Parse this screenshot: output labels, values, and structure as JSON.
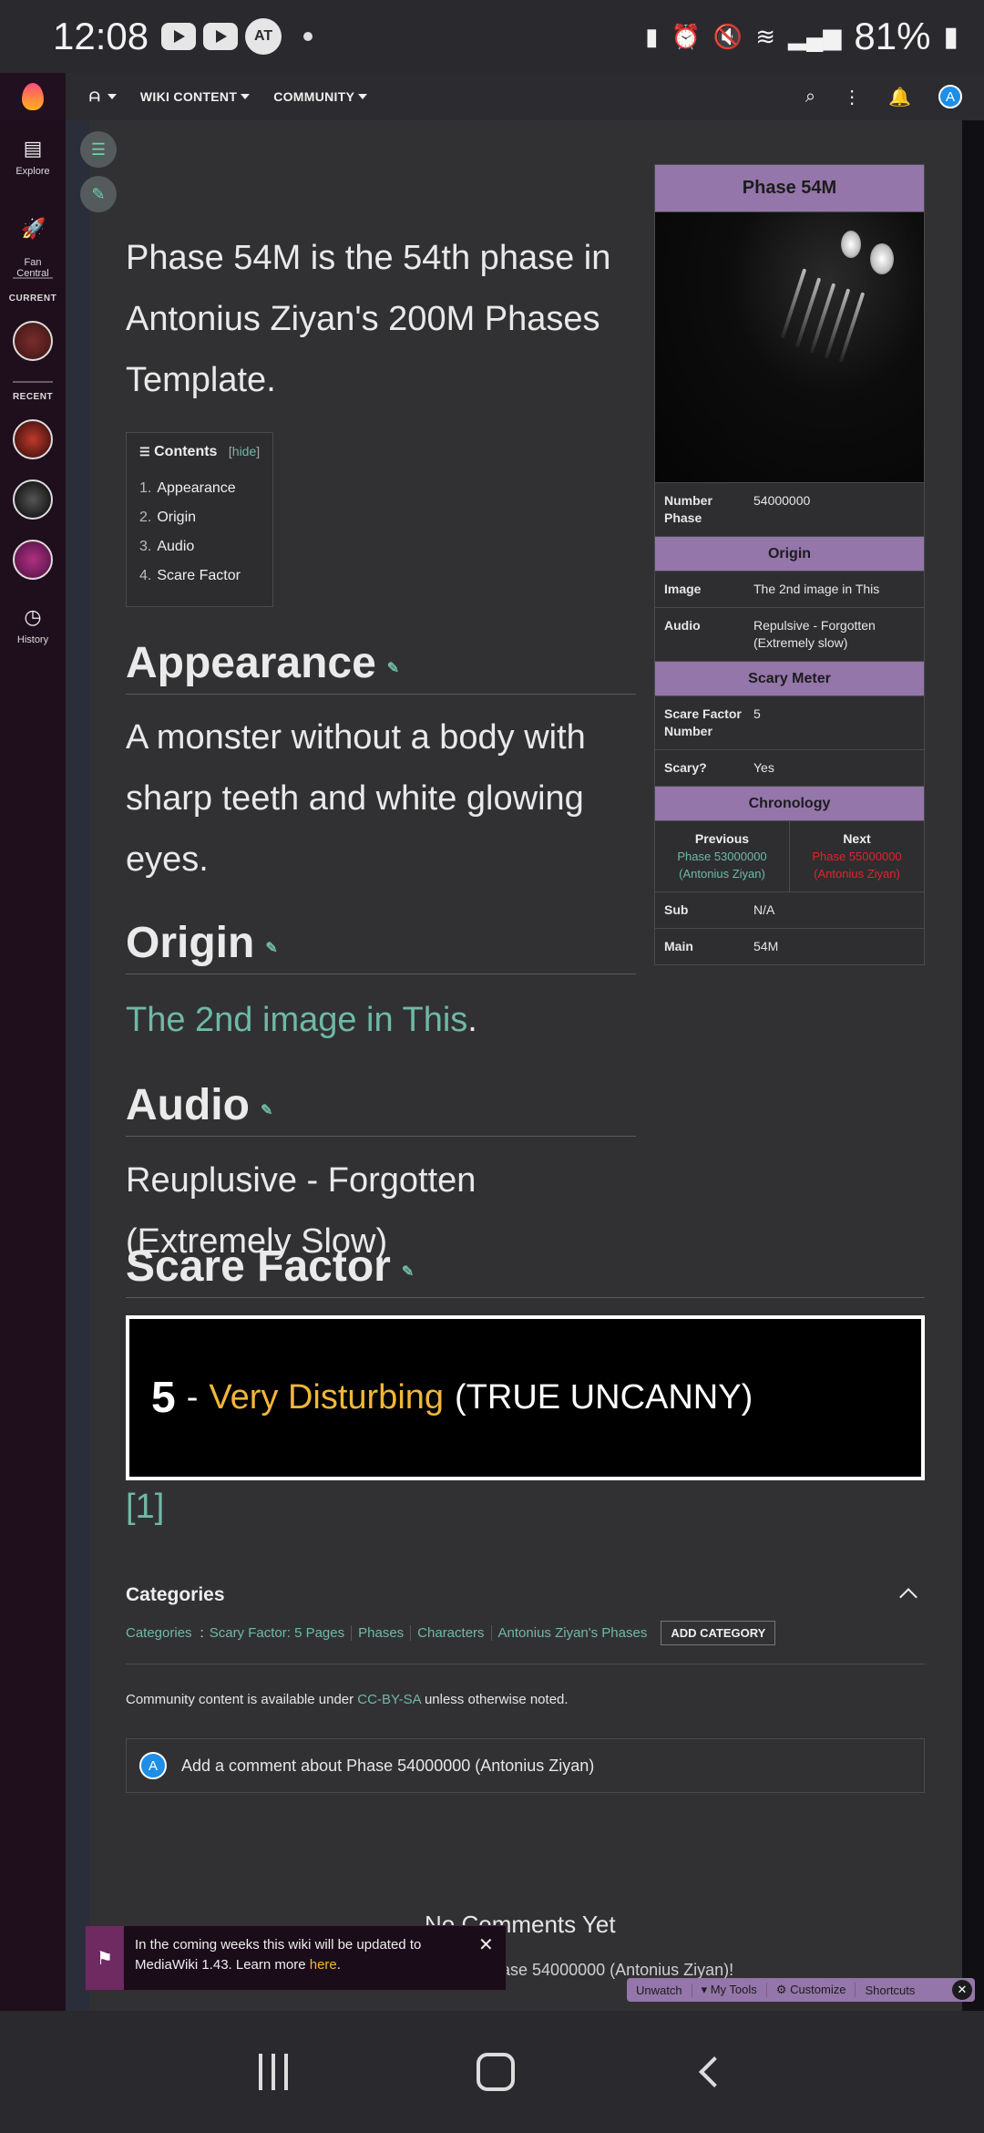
{
  "status_bar": {
    "time": "12:08",
    "battery": "81%",
    "small_icon_text": "AT"
  },
  "top_nav": {
    "logo_name": "fandom-logo",
    "items": [
      {
        "label": ""
      },
      {
        "label": "WIKI CONTENT"
      },
      {
        "label": "COMMUNITY"
      }
    ],
    "user_initial": "A"
  },
  "side_rail": {
    "explore": "Explore",
    "fan_central": "Fan\nCentral",
    "current": "CURRENT",
    "recent": "RECENT",
    "history": "History"
  },
  "article": {
    "lead": "Phase 54M is the 54th phase in Antonius Ziyan's 200M Phases Template.",
    "toc": {
      "title": "Contents",
      "hide": "hide",
      "items": [
        {
          "n": "1.",
          "label": "Appearance"
        },
        {
          "n": "2.",
          "label": "Origin"
        },
        {
          "n": "3.",
          "label": "Audio"
        },
        {
          "n": "4.",
          "label": "Scare Factor"
        }
      ]
    },
    "sections": {
      "appearance": {
        "heading": "Appearance",
        "text": "A monster without a body with sharp teeth and white glowing eyes."
      },
      "origin": {
        "heading": "Origin",
        "link": "The 2nd image in This",
        "suffix": "."
      },
      "audio": {
        "heading": "Audio",
        "text": "Reuplusive - Forgotten (Extremely Slow)"
      },
      "scare": {
        "heading": "Scare Factor",
        "number": "5",
        "dash": "-",
        "level": "Very Disturbing",
        "tag": "(TRUE UNCANNY)"
      }
    },
    "reference": "[1]"
  },
  "infobox": {
    "title": "Phase 54M",
    "number_phase_label": "Number Phase",
    "number_phase": "54000000",
    "origin_header": "Origin",
    "image_label": "Image",
    "image_value": "The 2nd image in This",
    "audio_label": "Audio",
    "audio_value": "Repulsive - Forgotten (Extremely slow)",
    "scary_header": "Scary Meter",
    "scare_label": "Scare Factor Number",
    "scare_value": "5",
    "scary_label": "Scary?",
    "scary_value": "Yes",
    "chron_header": "Chronology",
    "prev_label": "Previous",
    "prev_value": "Phase 53000000 (Antonius Ziyan)",
    "next_label": "Next",
    "next_value": "Phase 55000000 (Antonius Ziyan)",
    "sub_label": "Sub",
    "sub_value": "N/A",
    "main_label": "Main",
    "main_value": "54M"
  },
  "categories": {
    "title": "Categories",
    "lead": "Categories",
    "items": [
      "Scary Factor: 5 Pages",
      "Phases",
      "Characters",
      "Antonius Ziyan's Phases"
    ],
    "add": "ADD CATEGORY"
  },
  "license": {
    "pre": "Community content is available under ",
    "link": "CC-BY-SA",
    "post": " unless otherwise noted."
  },
  "comments": {
    "placeholder": "Add a comment about Phase 54000000 (Antonius Ziyan)",
    "empty_title": "No Comments Yet",
    "empty_sub": "hase 54000000 (Antonius Ziyan)!"
  },
  "toast": {
    "text": "In the coming weeks this wiki will be updated to MediaWiki 1.43. Learn more ",
    "link": "here",
    "end": "."
  },
  "toolbar": {
    "unwatch": "Unwatch",
    "my_tools": "My Tools",
    "customize": "Customize",
    "shortcuts": "Shortcuts"
  },
  "colors": {
    "accent": "#9476aa",
    "link": "#6fb9a6",
    "gold": "#f2b638",
    "redlink": "#e0242b"
  }
}
